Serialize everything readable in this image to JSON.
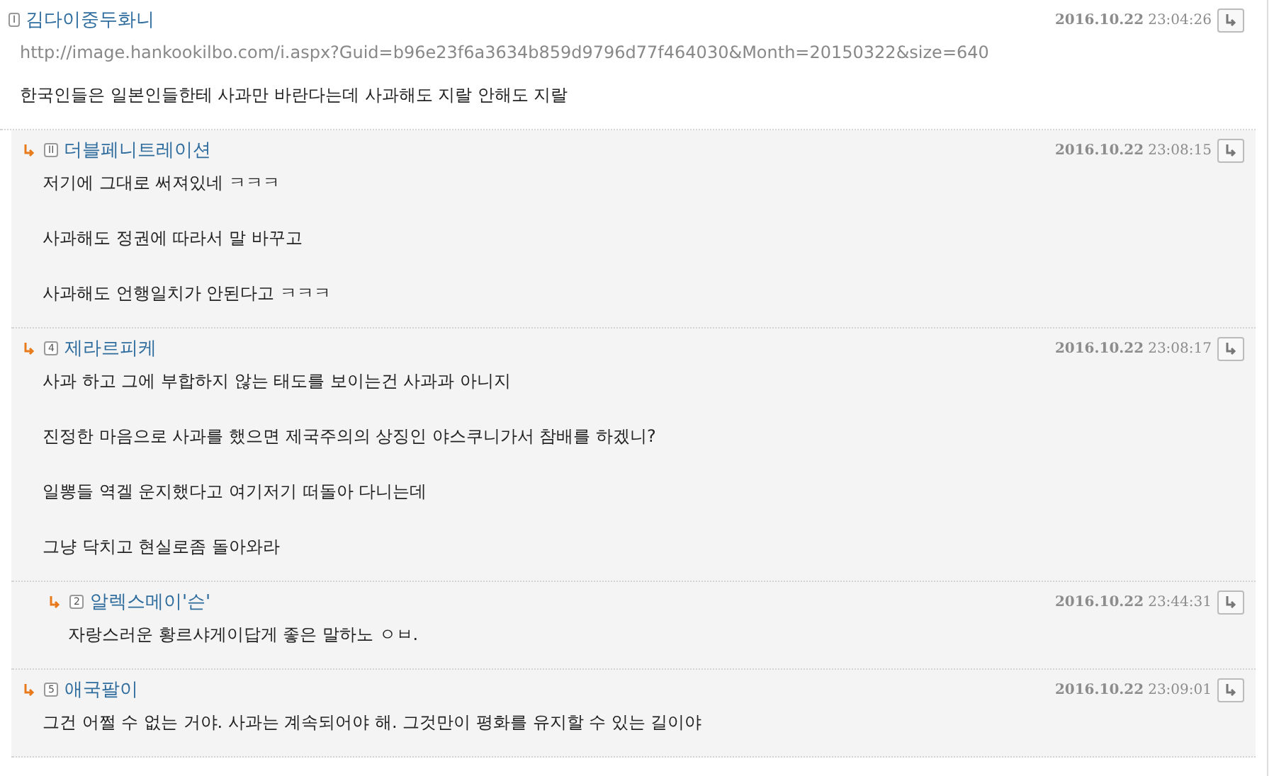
{
  "comments": [
    {
      "kind": "top",
      "level": "I",
      "author": "김다이중두화니",
      "date": "2016.10.22",
      "time": "23:04:26",
      "url": "http://image.hankookilbo.com/i.aspx?Guid=b96e23f6a3634b859d9796d77f464030&Month=20150322&size=640",
      "paragraphs": [
        "한국인들은 일본인들한테 사과만 바란다는데 사과해도 지랄 안해도 지랄"
      ]
    },
    {
      "kind": "reply",
      "level": "II",
      "author": "더블페니트레이션",
      "date": "2016.10.22",
      "time": "23:08:15",
      "paragraphs": [
        "저기에 그대로 써져있네 ㅋㅋㅋ",
        "사과해도 정권에 따라서 말 바꾸고",
        "사과해도 언행일치가 안된다고 ㅋㅋㅋ"
      ]
    },
    {
      "kind": "reply",
      "level": "4",
      "author": "제라르피케",
      "date": "2016.10.22",
      "time": "23:08:17",
      "paragraphs": [
        "사과 하고 그에 부합하지 않는 태도를 보이는건 사과과 아니지",
        "진정한 마음으로 사과를 했으면 제국주의의 상징인 야스쿠니가서 참배를 하겠니?",
        "일뽕들 역겔 운지했다고 여기저기 떠돌아 다니는데",
        "그냥 닥치고 현실로좀 돌아와라"
      ],
      "children": [
        {
          "kind": "reply",
          "level": "2",
          "author": "알렉스메이'슨'",
          "date": "2016.10.22",
          "time": "23:44:31",
          "paragraphs": [
            "자랑스러운 황르샤게이답게 좋은 말하노 ㅇㅂ."
          ]
        }
      ]
    },
    {
      "kind": "reply",
      "level": "5",
      "author": "애국팔이",
      "date": "2016.10.22",
      "time": "23:09:01",
      "paragraphs": [
        "그건 어쩔 수 없는 거야. 사과는 계속되어야 해. 그것만이 평화를 유지할 수 있는 길이야"
      ]
    }
  ]
}
